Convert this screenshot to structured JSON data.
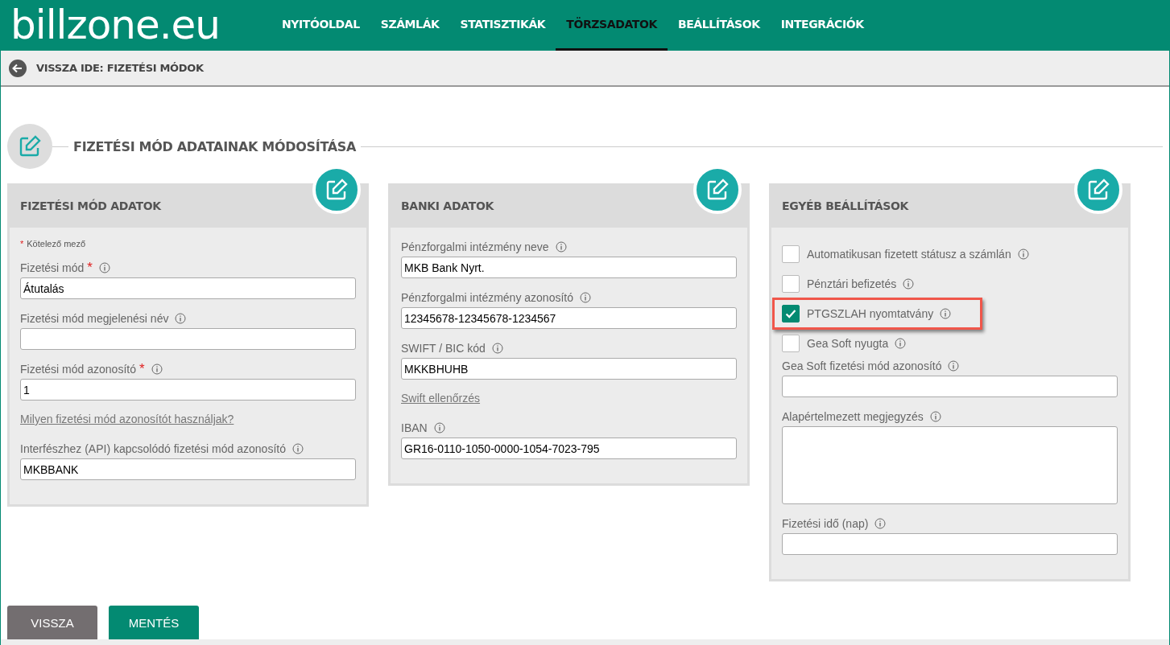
{
  "logo": {
    "text": "billzone.eu"
  },
  "nav": [
    {
      "label": "NYITÓOLDAL",
      "selected": false
    },
    {
      "label": "SZÁMLÁK",
      "selected": false
    },
    {
      "label": "STATISZTIKÁK",
      "selected": false
    },
    {
      "label": "TÖRZSADATOK",
      "selected": true
    },
    {
      "label": "BEÁLLÍTÁSOK",
      "selected": false
    },
    {
      "label": "INTEGRÁCIÓK",
      "selected": false
    }
  ],
  "back_link": {
    "label": "VISSZA IDE: FIZETÉSI MÓDOK"
  },
  "page_title": "FIZETÉSI MÓD ADATAINAK MÓDOSÍTÁSA",
  "panels": [
    {
      "title": "FIZETÉSI MÓD ADATOK",
      "items": [
        {
          "kind": "note",
          "mark": "*",
          "text": "Kötelező mező"
        },
        {
          "kind": "field",
          "label": "Fizetési mód",
          "required_mark": "*",
          "info": true,
          "value": "Átutalás"
        },
        {
          "kind": "field",
          "label": "Fizetési mód megjelenési név",
          "info": true
        },
        {
          "kind": "field",
          "label": "Fizetési mód azonosító",
          "required_mark": "*",
          "info": true,
          "value": "1"
        },
        {
          "kind": "link",
          "text": "Milyen fizetési mód azonosítót használjak?"
        },
        {
          "kind": "field",
          "label": "Interfészhez (API) kapcsolódó fizetési mód azonosító",
          "info": true,
          "value": "MKBBANK"
        }
      ]
    },
    {
      "title": "BANKI ADATOK",
      "items": [
        {
          "kind": "field",
          "label": "Pénzforgalmi intézmény neve",
          "info": true,
          "value": "MKB Bank Nyrt."
        },
        {
          "kind": "field",
          "label": "Pénzforgalmi intézmény azonosító",
          "info": true,
          "value": "12345678-12345678-1234567"
        },
        {
          "kind": "field",
          "label": "SWIFT / BIC kód",
          "info": true,
          "value": "MKKBHUHB"
        },
        {
          "kind": "link",
          "text": "Swift ellenőrzés"
        },
        {
          "kind": "field",
          "label": "IBAN",
          "info": true,
          "value": "GR16-0110-1050-0000-1054-7023-795"
        }
      ]
    },
    {
      "title": "EGYÉB BEÁLLÍTÁSOK",
      "items": [
        {
          "kind": "checkbox",
          "label": "Automatikusan fizetett státusz a számlán",
          "info": true,
          "checked": false,
          "highlighted": false
        },
        {
          "kind": "checkbox",
          "label": "Pénztári befizetés",
          "info": true,
          "checked": false,
          "highlighted": false
        },
        {
          "kind": "checkbox",
          "label": "PTGSZLAH nyomtatvány",
          "info": true,
          "checked": true,
          "highlighted": true
        },
        {
          "kind": "checkbox",
          "label": "Gea Soft nyugta",
          "info": true,
          "checked": false,
          "highlighted": false
        },
        {
          "kind": "field",
          "label": "Gea Soft fizetési mód azonosító",
          "info": true
        },
        {
          "kind": "textarea",
          "label": "Alapértelmezett megjegyzés",
          "info": true
        },
        {
          "kind": "field",
          "label": "Fizetési idő (nap)",
          "info": true
        }
      ]
    }
  ],
  "buttons": [
    {
      "label": "VISSZA",
      "kind": "secondary"
    },
    {
      "label": "MENTÉS",
      "kind": "primary"
    }
  ]
}
